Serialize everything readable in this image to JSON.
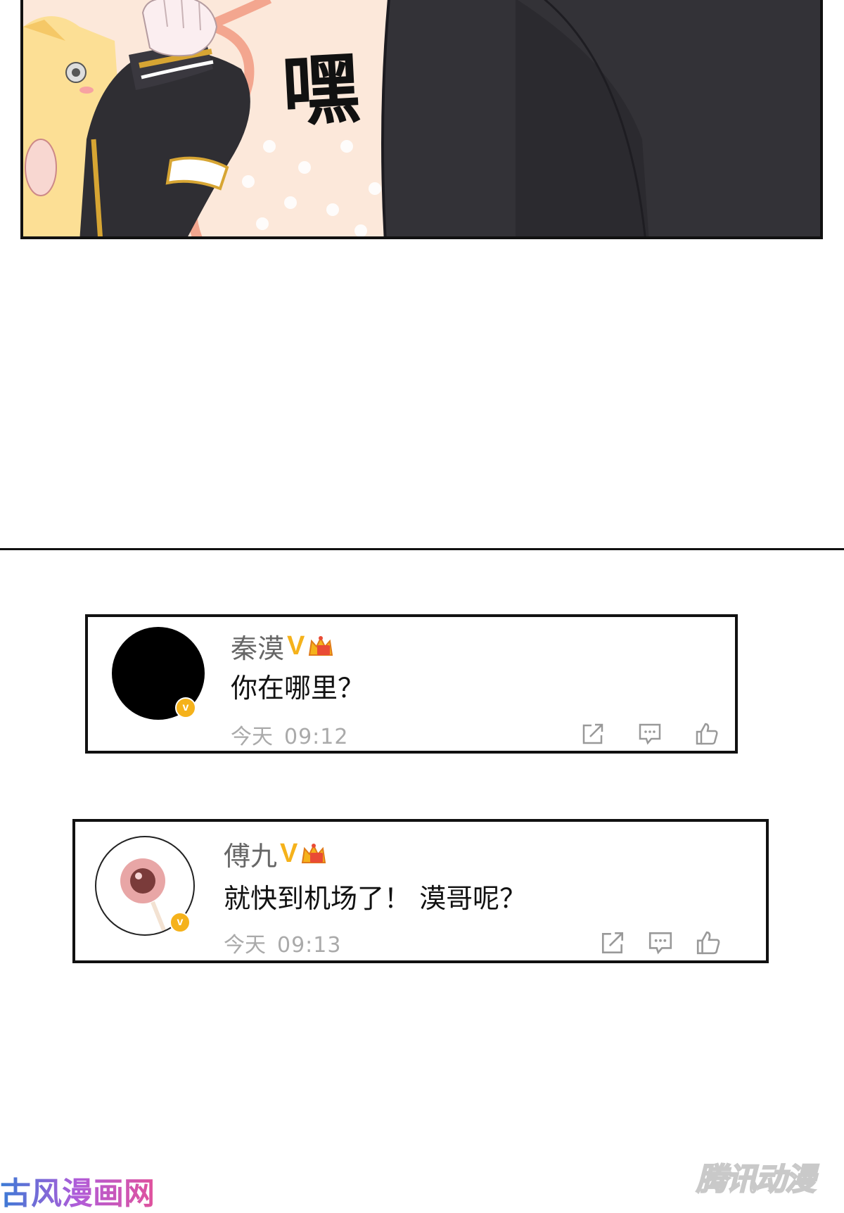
{
  "panel": {
    "sfx_text": "嘿"
  },
  "comments": [
    {
      "username": "秦漠",
      "verified_mark": "V",
      "badge_letter": "v",
      "message": "你在哪里？",
      "day": "今天",
      "time": "09:12",
      "avatar_color": "#000000"
    },
    {
      "username": "傅九",
      "verified_mark": "V",
      "badge_letter": "v",
      "message": "就快到机场了！ 漠哥呢？",
      "day": "今天",
      "time": "09:13",
      "avatar_color": "#ffffff"
    }
  ],
  "action_icons": [
    "share-icon",
    "comment-icon",
    "like-icon"
  ],
  "watermarks": {
    "left": "古风漫画网",
    "right": "腾讯动漫"
  },
  "colors": {
    "verified": "#f5b21b",
    "meta_text": "#aaaaaa",
    "username_text": "#666666"
  }
}
